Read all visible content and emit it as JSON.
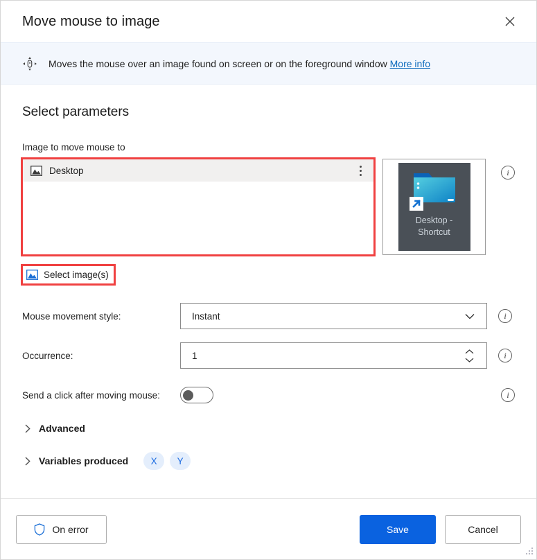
{
  "window": {
    "title": "Move mouse to image",
    "close_label": "✕"
  },
  "banner": {
    "icon": "move-mouse-icon",
    "text": "Moves the mouse over an image found on screen or on the foreground window",
    "link_label": "More info"
  },
  "main": {
    "section_title": "Select parameters",
    "image_field": {
      "label": "Image to move mouse to",
      "items": [
        {
          "icon": "picture-icon",
          "label": "Desktop"
        }
      ],
      "thumbnail": {
        "caption_line1": "Desktop -",
        "caption_line2": "Shortcut"
      },
      "select_button_label": "Select image(s)"
    },
    "params": [
      {
        "label": "Mouse movement style:",
        "type": "dropdown",
        "value": "Instant",
        "options": [
          "Instant"
        ]
      },
      {
        "label": "Occurrence:",
        "type": "number",
        "value": "1"
      }
    ],
    "toggle": {
      "label": "Send a click after moving mouse:",
      "state": "off"
    },
    "expanders": [
      {
        "label": "Advanced",
        "expanded": false,
        "pills": []
      },
      {
        "label": "Variables produced",
        "expanded": false,
        "pills": [
          "X",
          "Y"
        ]
      }
    ]
  },
  "footer": {
    "on_error_label": "On error",
    "save_label": "Save",
    "cancel_label": "Cancel"
  },
  "colors": {
    "accent": "#0a62e0",
    "link": "#0f6cbd",
    "highlight": "#f04040",
    "banner_bg": "#f3f7fd",
    "pill_bg": "#e4eefc",
    "pill_text": "#1a6ae0"
  }
}
